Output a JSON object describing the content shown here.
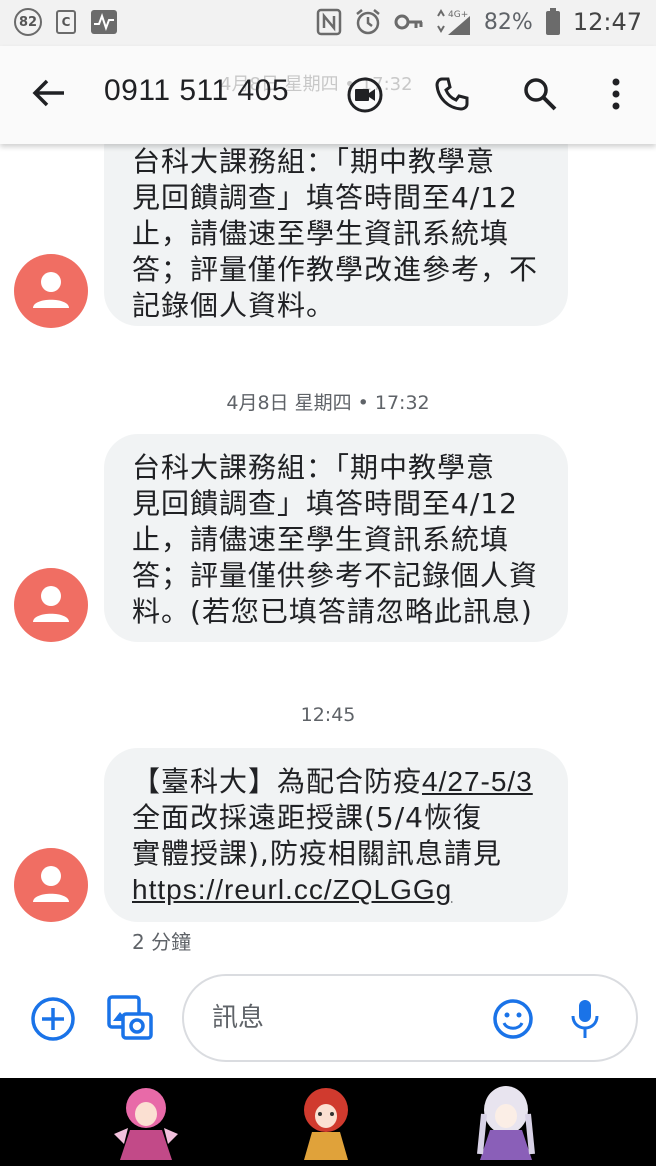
{
  "status_bar": {
    "notif_badge": "82",
    "battery_percent": "82%",
    "time": "12:47",
    "network": "4G+"
  },
  "header": {
    "phone_number": "0911 511 405",
    "faded_date_text": "4月8日 星期四 • 17:32"
  },
  "messages": [
    {
      "lines": [
        "台科大課務組：「期中教學意",
        "見回饋調查」填答時間至4/12",
        "止，請儘速至學生資訊系統填",
        "答；評量僅作教學改進參考，不",
        "記錄個人資料。"
      ]
    },
    {
      "date_separator": "4月8日 星期四 • 17:32",
      "lines": [
        "台科大課務組：「期中教學意",
        "見回饋調查」填答時間至4/12",
        "止，請儘速至學生資訊系統填",
        "答；評量僅供參考不記錄個人資",
        "料。(若您已填答請忽略此訊息)"
      ]
    },
    {
      "date_separator": "12:45",
      "line1_prefix": "【臺科大】為配合防疫",
      "line1_link": "4/27-5/3",
      "lines": [
        "全面改採遠距授課(5/4恢復",
        "實體授課),防疫相關訊息請見"
      ],
      "url": "https://reurl.cc/ZQLGGg",
      "time_ago": "2 分鐘"
    }
  ],
  "compose": {
    "placeholder": "訊息"
  },
  "colors": {
    "avatar": "#f06e63",
    "bubble": "#f1f3f4",
    "accent_blue": "#1a73e8",
    "icon_dark": "#202124"
  }
}
